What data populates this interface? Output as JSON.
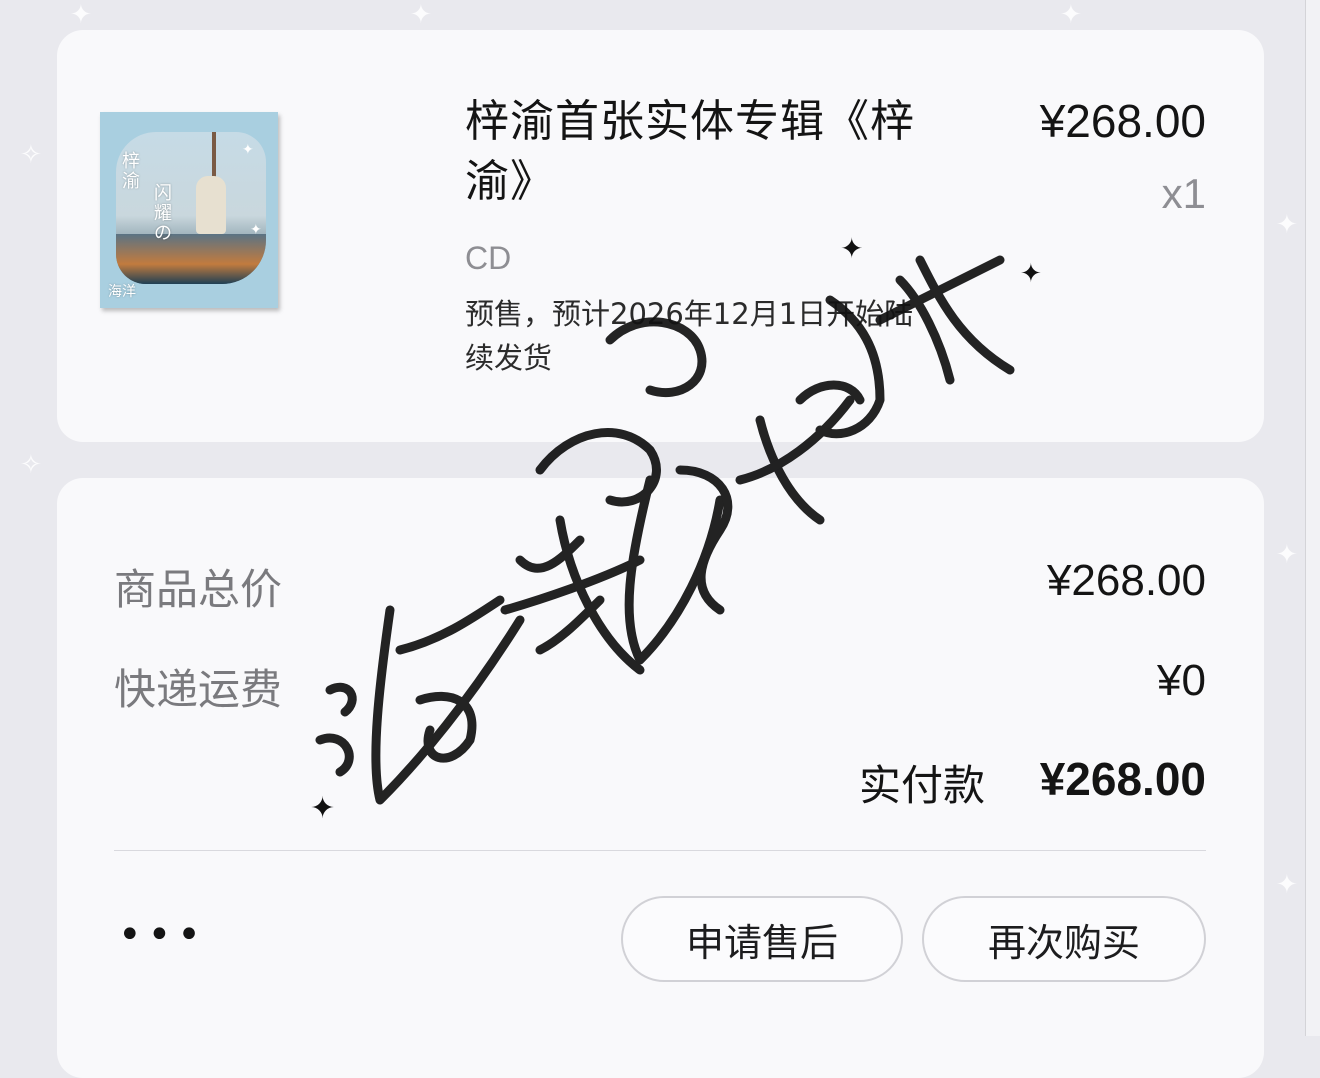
{
  "product": {
    "title": "梓渝首张实体专辑《梓渝》",
    "price": "¥268.00",
    "quantity": "x1",
    "variant": "CD",
    "presale_note": "预售，预计2026年12月1日开始陆续发货",
    "album_art": {
      "cover_title": "梓渝",
      "cover_subtitle": "闪耀の",
      "cover_caption": "海洋",
      "colors": {
        "sky": "#a9cfe0",
        "deck": "#c27b3e",
        "sea": "#1f3f54"
      }
    }
  },
  "summary": {
    "subtotal_label": "商品总价",
    "subtotal_value": "¥268.00",
    "shipping_label": "快递运费",
    "shipping_value": "¥0",
    "paid_label": "实付款",
    "paid_value": "¥268.00"
  },
  "actions": {
    "more_label": "•••",
    "aftersale_label": "申请售后",
    "rebuy_label": "再次购买"
  },
  "watermark": {
    "handwritten_text": "海洋极速冲",
    "style": "handwritten brush signature overlay"
  },
  "icons": {
    "more": "more-dots-icon",
    "sparkle": "sparkle-icon"
  },
  "colors": {
    "background": "#e9e9ee",
    "card": "#f9f9fb",
    "muted_text": "#7a7a7e",
    "primary_text": "#141414"
  }
}
